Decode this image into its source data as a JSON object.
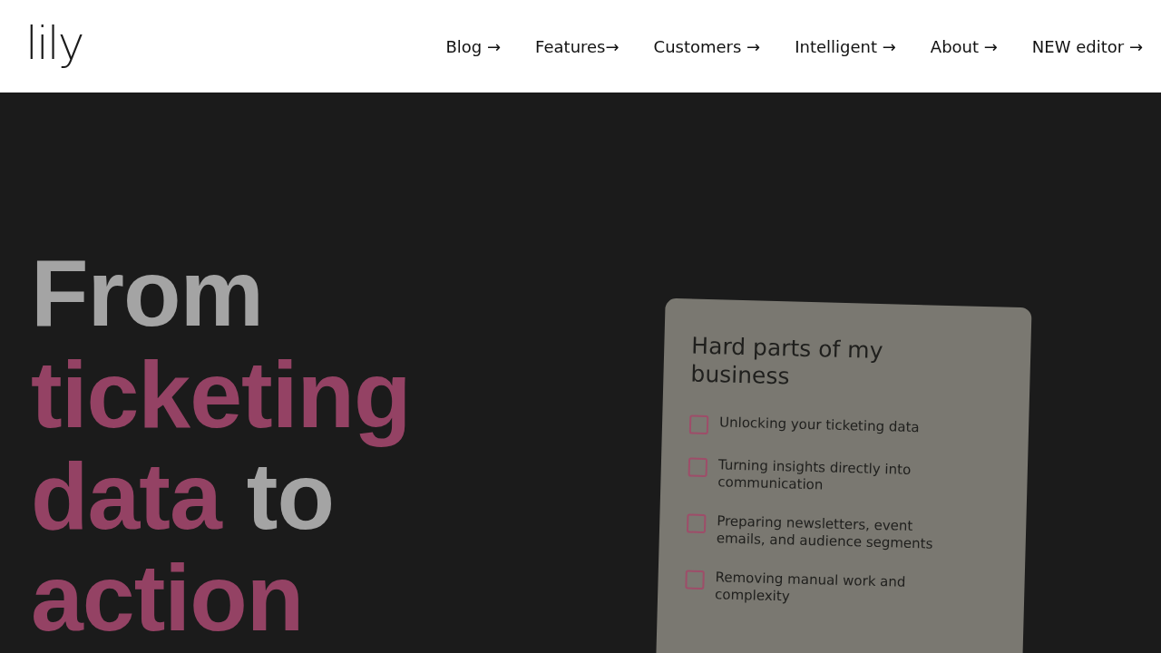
{
  "header": {
    "logo": "lily",
    "nav": [
      {
        "label": "Blog →"
      },
      {
        "label": "Features→"
      },
      {
        "label": "Customers →"
      },
      {
        "label": "Intelligent →"
      },
      {
        "label": "About →"
      },
      {
        "label": "NEW editor →"
      }
    ]
  },
  "hero": {
    "headline": [
      [
        {
          "text": "From",
          "accent": false
        }
      ],
      [
        {
          "text": "ticketing",
          "accent": true
        }
      ],
      [
        {
          "text": "data",
          "accent": true
        },
        {
          "text": "to",
          "accent": false
        }
      ],
      [
        {
          "text": "action",
          "accent": true
        }
      ]
    ],
    "card": {
      "title": "Hard parts of my business",
      "items": [
        {
          "label": "Unlocking your ticketing data",
          "checked": false
        },
        {
          "label": "Turning insights directly into communication",
          "checked": false
        },
        {
          "label": "Preparing newsletters, event emails, and audience segments",
          "checked": false
        },
        {
          "label": "Removing manual work and complexity",
          "checked": false
        }
      ]
    }
  }
}
